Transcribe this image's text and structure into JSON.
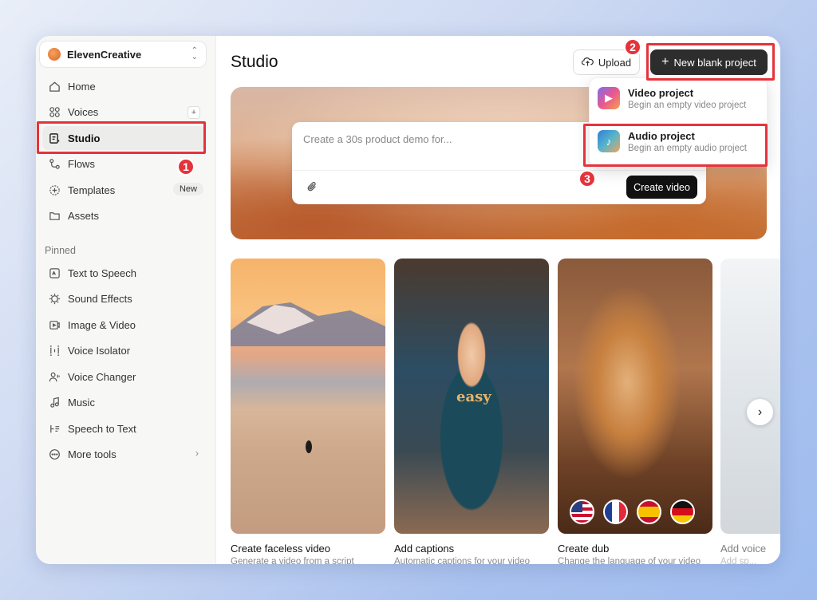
{
  "workspace": {
    "name": "ElevenCreative"
  },
  "nav": [
    {
      "label": "Home",
      "icon": "home-icon"
    },
    {
      "label": "Voices",
      "icon": "voices-icon",
      "action": "+"
    },
    {
      "label": "Studio",
      "icon": "studio-icon",
      "active": true
    },
    {
      "label": "Flows",
      "icon": "flows-icon"
    },
    {
      "label": "Templates",
      "icon": "templates-icon",
      "badge": "New"
    },
    {
      "label": "Assets",
      "icon": "folder-icon"
    }
  ],
  "pinned": {
    "title": "Pinned",
    "items": [
      {
        "label": "Text to Speech",
        "icon": "text-to-speech-icon"
      },
      {
        "label": "Sound Effects",
        "icon": "sound-effects-icon"
      },
      {
        "label": "Image & Video",
        "icon": "image-video-icon"
      },
      {
        "label": "Voice Isolator",
        "icon": "voice-isolator-icon"
      },
      {
        "label": "Voice Changer",
        "icon": "voice-changer-icon"
      },
      {
        "label": "Music",
        "icon": "music-icon"
      },
      {
        "label": "Speech to Text",
        "icon": "speech-to-text-icon"
      },
      {
        "label": "More tools",
        "icon": "more-tools-icon"
      }
    ]
  },
  "header": {
    "title": "Studio",
    "upload_label": "Upload",
    "new_project_label": "New blank project"
  },
  "prompt": {
    "placeholder": "Create a 30s product demo for...",
    "create_label": "Create video"
  },
  "dropdown": {
    "items": [
      {
        "title": "Video project",
        "subtitle": "Begin an empty video project"
      },
      {
        "title": "Audio project",
        "subtitle": "Begin an empty audio project"
      }
    ]
  },
  "steps": [
    "1",
    "2",
    "3"
  ],
  "cards": [
    {
      "title": "Create faceless video",
      "subtitle": "Generate a video from a script"
    },
    {
      "title": "Add captions",
      "subtitle": "Automatic captions for your video",
      "overlay": "easy"
    },
    {
      "title": "Create dub",
      "subtitle": "Change the language of your video"
    },
    {
      "title": "Add voice",
      "subtitle": "Add sp..."
    }
  ],
  "colors": {
    "highlight": "#e5333b",
    "primary_button": "#2d2d2d"
  }
}
